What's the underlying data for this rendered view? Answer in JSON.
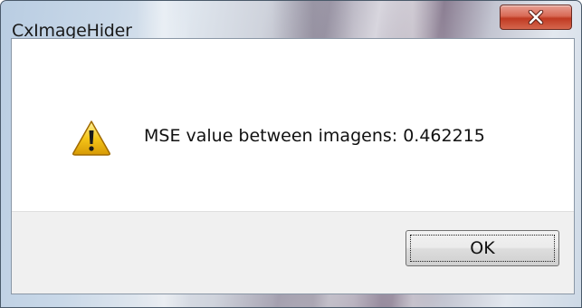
{
  "window": {
    "title": "CxImageHider",
    "close_icon": "close-icon"
  },
  "dialog": {
    "icon": "warning-icon",
    "message": "MSE value between imagens: 0.462215",
    "ok_label": "OK"
  },
  "colors": {
    "close_button": "#d0553c",
    "warning_fill": "#f5c518",
    "client_bg": "#ffffff",
    "button_area_bg": "#f0f0f0"
  }
}
